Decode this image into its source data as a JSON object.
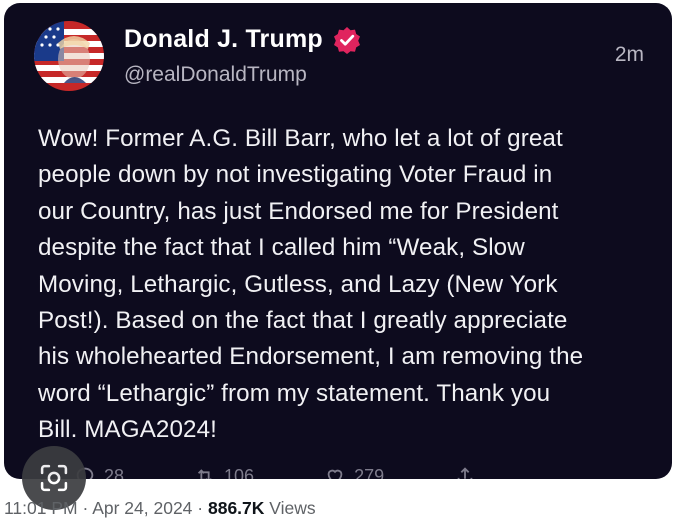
{
  "tweet": {
    "display_name": "Donald J. Trump",
    "handle": "@realDonaldTrump",
    "relative_time": "2m",
    "text": "Wow! Former A.G. Bill Barr, who let a lot of great\npeople down by not investigating Voter Fraud in\nour Country, has just Endorsed me for President\ndespite the fact that I called him “Weak, Slow\nMoving, Lethargic, Gutless, and Lazy (New York\nPost!). Based on the fact that I greatly appreciate\nhis wholehearted Endorsement, I am removing the\nword “Lethargic” from my statement. Thank you\nBill. MAGA2024!",
    "verified_badge_color": "#e0245e",
    "actions": {
      "reply_count": "28",
      "repost_count": "106",
      "like_count": "279",
      "reply_icon": "reply-icon",
      "repost_icon": "repost-icon",
      "like_icon": "heart-icon",
      "share_icon": "share-icon"
    }
  },
  "meta": {
    "time": "11:01 PM",
    "separator_1": " · ",
    "date": "Apr 24, 2024",
    "separator_2": " · ",
    "views_count": "886.7K",
    "views_label": " Views"
  },
  "overlay": {
    "lens_icon": "lens-search-icon"
  },
  "colors": {
    "card_background": "#0d0b1e",
    "text": "#f1f1f4",
    "muted": "#b8b6c2"
  }
}
